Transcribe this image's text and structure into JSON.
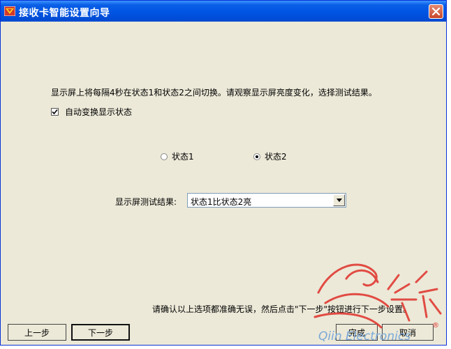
{
  "window": {
    "title": "接收卡智能设置向导",
    "close_label": "×"
  },
  "main": {
    "instruction": "显示屏上将每隔4秒在状态1和状态2之间切换。请观察显示屏亮度变化，选择测试结果。",
    "auto_switch": {
      "label": "自动变换显示状态",
      "checked": true
    },
    "radios": [
      {
        "label": "状态1",
        "checked": false
      },
      {
        "label": "状态2",
        "checked": true
      }
    ],
    "result_label": "显示屏测试结果:",
    "result_value": "状态1比状态2亮",
    "confirm_text": "请确认以上选项都准确无误，然后点击\"下一步\"按钮进行下一步设置。"
  },
  "buttons": {
    "prev": "上一步",
    "next": "下一步",
    "finish": "完成",
    "cancel": "取消"
  },
  "watermark": {
    "text": "Qiin Electronics",
    "registered": "®"
  },
  "colors": {
    "titlebar": "#0054e3",
    "window_bg": "#ece9d8",
    "close_button": "#c8462b",
    "watermark": "#e0302a"
  }
}
